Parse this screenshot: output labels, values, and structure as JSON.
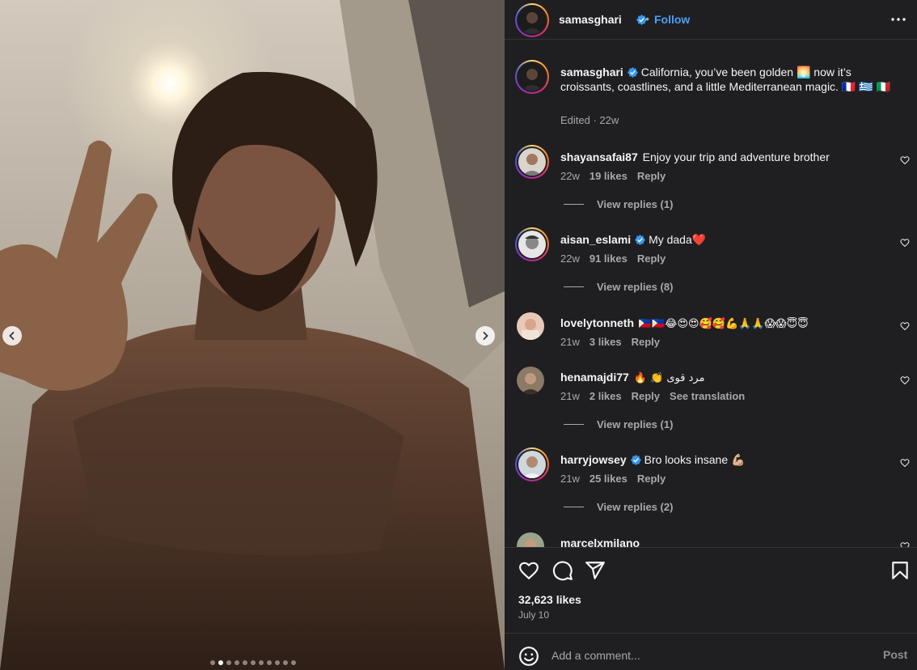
{
  "post": {
    "author": "samasghari",
    "follow_label": "Follow",
    "follow_separator": "•",
    "caption": "California, you’ve been golden 🌅 now it’s croissants, coastlines, and a little Mediterranean magic. 🇫🇷 🇬🇷 🇮🇹",
    "caption_meta": "Edited · 22w",
    "likes": "32,623 likes",
    "date": "July 10",
    "carousel": {
      "total": 11,
      "active_index": 1
    }
  },
  "comments": [
    {
      "username": "shayansafai87",
      "verified": false,
      "text": "Enjoy your trip and adventure brother",
      "age": "22w",
      "likes": "19 likes",
      "reply": "Reply",
      "view_replies": "View replies (1)"
    },
    {
      "username": "aisan_eslami",
      "verified": true,
      "text": "My dada❤️",
      "age": "22w",
      "likes": "91 likes",
      "reply": "Reply",
      "view_replies": "View replies (8)"
    },
    {
      "username": "lovelytonneth",
      "verified": false,
      "text": "🇵🇭🇵🇭😂😍😍🥰🥰💪🙏🙏😱😱😇😇",
      "age": "21w",
      "likes": "3 likes",
      "reply": "Reply"
    },
    {
      "username": "henamajdi77",
      "verified": false,
      "text": "🔥 👏 مرد قوی",
      "age": "21w",
      "likes": "2 likes",
      "reply": "Reply",
      "translate": "See translation",
      "view_replies": "View replies (1)"
    },
    {
      "username": "harryjowsey",
      "verified": true,
      "text": "Bro looks insane 💪🏼",
      "age": "21w",
      "likes": "25 likes",
      "reply": "Reply",
      "view_replies": "View replies (2)"
    },
    {
      "username": "marcelxmilano",
      "verified": false,
      "text": ""
    }
  ],
  "composer": {
    "placeholder": "Add a comment...",
    "post_label": "Post"
  },
  "icons": {
    "header": [
      "verified-badge-icon",
      "more-options-icon"
    ],
    "actions": [
      "heart-icon",
      "comment-icon",
      "share-icon",
      "save-icon"
    ],
    "composer": "emoji-icon",
    "carousel": [
      "chevron-left-icon",
      "chevron-right-icon"
    ]
  },
  "colors": {
    "panel_bg": "#1f1f22",
    "text_primary": "#f5f5f5",
    "text_secondary": "#a8a8a8",
    "link_blue": "#4a9ff5",
    "verified_blue": "#3897f0"
  }
}
